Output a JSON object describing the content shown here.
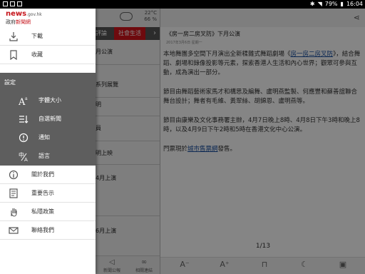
{
  "status_bar": {
    "battery": "79%",
    "time": "16:04"
  },
  "weather": {
    "temp": "22°C",
    "humidity": "66 %"
  },
  "list_tabs": [
    {
      "label": "評論"
    },
    {
      "label": "社會生活"
    }
  ],
  "list_items": [
    "月公演",
    "系列展覽",
    "明",
    "員",
    "明上映",
    "4月上演",
    "6月上演"
  ],
  "bottom_nav": [
    {
      "label": "新聞公報"
    },
    {
      "label": "相關連結"
    }
  ],
  "article": {
    "title": "《房一房二房叉防》下月公演",
    "date": "2017年3月6日 星期一",
    "p1_a": "本地舞團多空間下月演出全新糅雜式舞蹈劇場《",
    "p1_link": "房一房二房叉防",
    "p1_b": "》，結合舞蹈、劇場和錄像投影等元素，探索香港人生活和內心世界；觀眾可參與互動，成為演出一部分。",
    "p2": "節目由舞蹈藝術家馬才和構思及編舞、盧明燕監製、何應豐和蘇善誼聯合舞台設計；舞者有毛維、黃翠絲、胡錦恩、盧明燕等。",
    "p3": "節目由康樂及文化事務署主辦，4月7日晚上8時、4月8日下午3時和晚上8時，以及4月9日下午2時和5時在香港文化中心公演。",
    "p4_a": "門票現於",
    "p4_link": "城市售票網",
    "p4_b": "發售。",
    "pager": "1/13"
  },
  "drawer": {
    "logo_domain_main": "news",
    "logo_domain_suffix": ".gov.hk",
    "logo_name_a": "政府",
    "logo_name_b": "新聞網",
    "download": "下載",
    "favorites": "收藏",
    "settings_header": "設定",
    "font_size": "字體大小",
    "subscribe": "自選新聞",
    "notifications": "通知",
    "language": "語言",
    "about": "關於我們",
    "disclaimer": "重要告示",
    "privacy": "私隱政策",
    "contact": "聯絡我們"
  }
}
